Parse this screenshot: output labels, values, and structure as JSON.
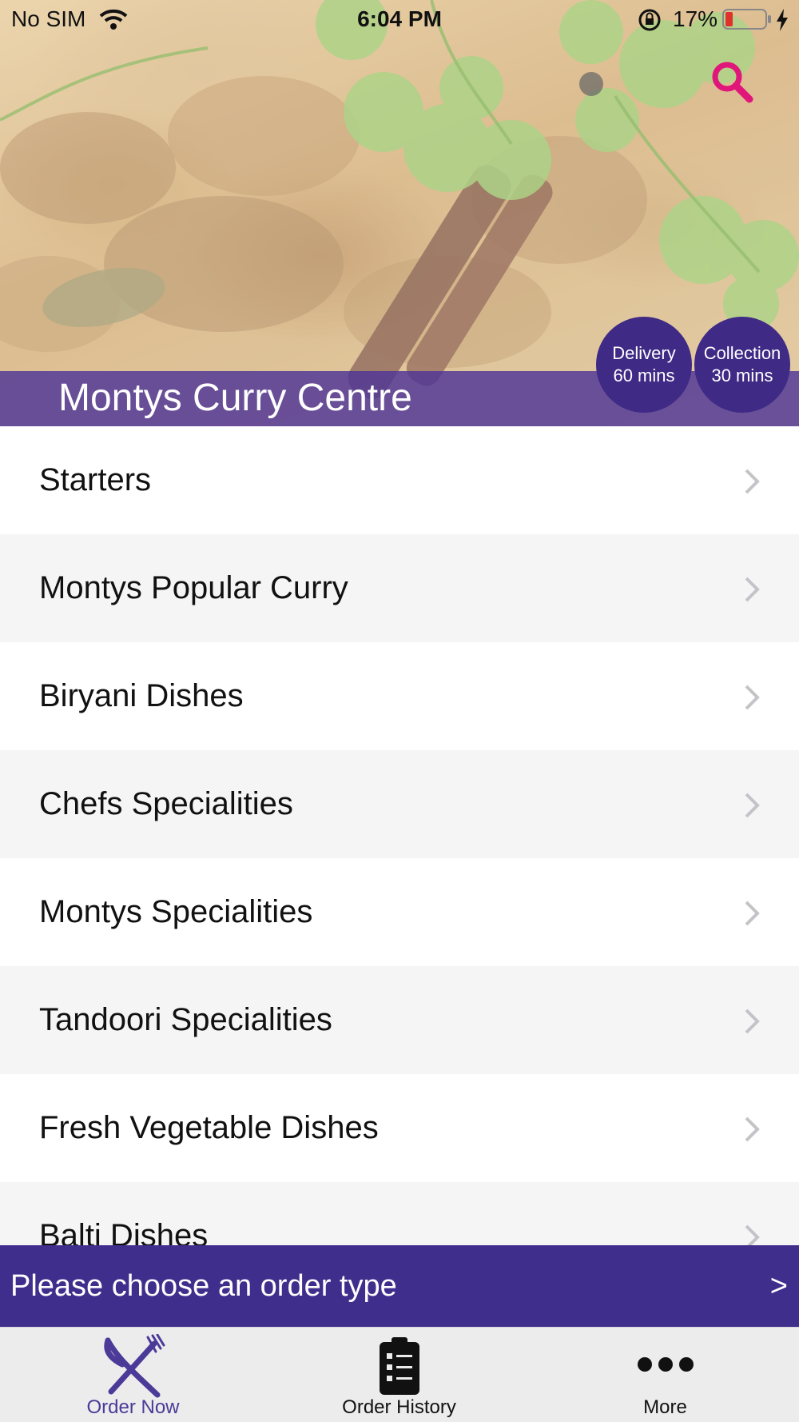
{
  "status_bar": {
    "carrier": "No SIM",
    "time": "6:04 PM",
    "battery_percent": "17%"
  },
  "header": {
    "restaurant_name": "Montys Curry Centre",
    "delivery": {
      "label": "Delivery",
      "time": "60 mins"
    },
    "collection": {
      "label": "Collection",
      "time": "30 mins"
    }
  },
  "menu": {
    "categories": [
      "Starters",
      "Montys Popular Curry",
      "Biryani Dishes",
      "Chefs Specialities",
      "Montys Specialities",
      "Tandoori Specialities",
      "Fresh Vegetable Dishes",
      "Balti Dishes"
    ]
  },
  "order_bar": {
    "text": "Please choose an order type",
    "arrow": ">"
  },
  "tabs": [
    {
      "label": "Order Now",
      "icon": "fork-knife-icon",
      "active": true
    },
    {
      "label": "Order History",
      "icon": "clipboard-list-icon",
      "active": false
    },
    {
      "label": "More",
      "icon": "more-dots-icon",
      "active": false
    }
  ],
  "colors": {
    "brand_purple": "#3f2e8c",
    "badge_purple": "#3f2a86",
    "search_accent": "#e0167a",
    "active_tab": "#4b3a98"
  }
}
